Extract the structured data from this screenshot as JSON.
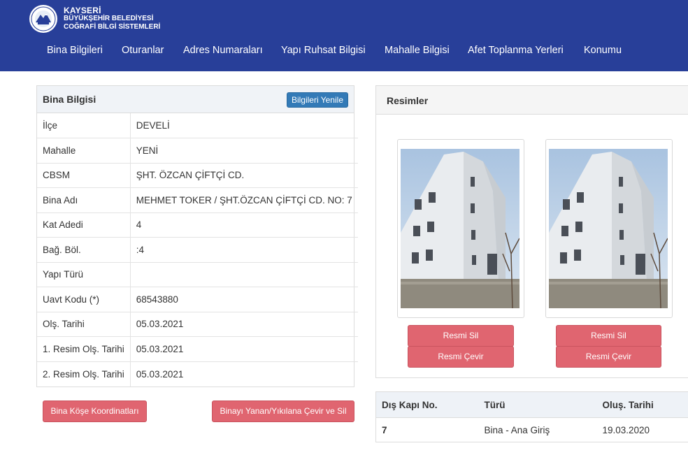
{
  "header": {
    "brand_line1": "KAYSERİ",
    "brand_line2": "BÜYÜKŞEHİR BELEDİYESİ",
    "brand_line3": "COĞRAFİ BİLGİ SİSTEMLERİ",
    "bg_color": "#283f99",
    "nav": [
      {
        "label": "Bina Bilgileri"
      },
      {
        "label": "Oturanlar"
      },
      {
        "label": "Adres Numaraları"
      },
      {
        "label": "Yapı Ruhsat Bilgisi"
      },
      {
        "label": "Mahalle Bilgisi"
      },
      {
        "label": "Afet Toplanma Yerleri"
      },
      {
        "label": "Konumu"
      }
    ]
  },
  "building_panel": {
    "title": "Bina Bilgisi",
    "refresh_button": "Bilgileri Yenile",
    "rows": [
      {
        "key": "İlçe",
        "value": "DEVELİ"
      },
      {
        "key": "Mahalle",
        "value": "YENİ"
      },
      {
        "key": "CBSM",
        "value": "ŞHT. ÖZCAN ÇİFTÇİ CD."
      },
      {
        "key": "Bina Adı",
        "value": "MEHMET TOKER / ŞHT.ÖZCAN ÇİFTÇİ CD. NO: 7"
      },
      {
        "key": "Kat Adedi",
        "value": "4"
      },
      {
        "key": "Bağ. Böl.",
        "value": ":4"
      },
      {
        "key": "Yapı Türü",
        "value": ""
      },
      {
        "key": "Uavt Kodu (*)",
        "value": "68543880"
      },
      {
        "key": "Olş. Tarihi",
        "value": "05.03.2021"
      },
      {
        "key": "1. Resim Olş. Tarihi",
        "value": "05.03.2021"
      },
      {
        "key": "2. Resim Olş. Tarihi",
        "value": "05.03.2021"
      }
    ],
    "corner_coords_button": "Bina Köşe Koordinatları",
    "demolish_button": "Binayı Yanan/Yıkılana Çevir ve Sil"
  },
  "images_panel": {
    "title": "Resimler",
    "photos": [
      {
        "delete_label": "Resmi Sil",
        "rotate_label": "Resmi Çevir"
      },
      {
        "delete_label": "Resmi Sil",
        "rotate_label": "Resmi Çevir"
      }
    ]
  },
  "doors_table": {
    "columns": [
      "Dış Kapı No.",
      "Türü",
      "Oluş. Tarihi"
    ],
    "rows": [
      {
        "no": "7",
        "type": "Bina - Ana Giriş",
        "date": "19.03.2020"
      }
    ]
  }
}
